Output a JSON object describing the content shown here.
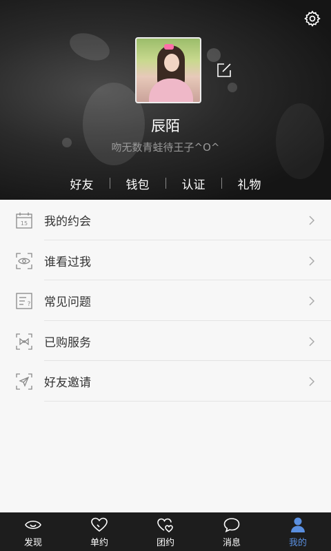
{
  "profile": {
    "name": "辰陌",
    "signature": "吻无数青蛙待王子^O^"
  },
  "quick_links": [
    "好友",
    "钱包",
    "认证",
    "礼物"
  ],
  "menu": [
    {
      "label": "我的约会",
      "icon": "calendar-icon"
    },
    {
      "label": "谁看过我",
      "icon": "eye-scan-icon"
    },
    {
      "label": "常见问题",
      "icon": "faq-document-icon"
    },
    {
      "label": "已购服务",
      "icon": "bow-tie-icon"
    },
    {
      "label": "好友邀请",
      "icon": "paper-plane-icon"
    }
  ],
  "tabs": [
    {
      "label": "发现",
      "icon": "eye-icon",
      "active": false
    },
    {
      "label": "单约",
      "icon": "heart-icon",
      "active": false
    },
    {
      "label": "团约",
      "icon": "group-heart-icon",
      "active": false
    },
    {
      "label": "消息",
      "icon": "chat-bubble-icon",
      "active": false
    },
    {
      "label": "我的",
      "icon": "person-icon",
      "active": true
    }
  ],
  "colors": {
    "accent": "#5a8fe0",
    "tabbar_bg": "#1d1d1d",
    "list_bg": "#f7f7f7"
  }
}
